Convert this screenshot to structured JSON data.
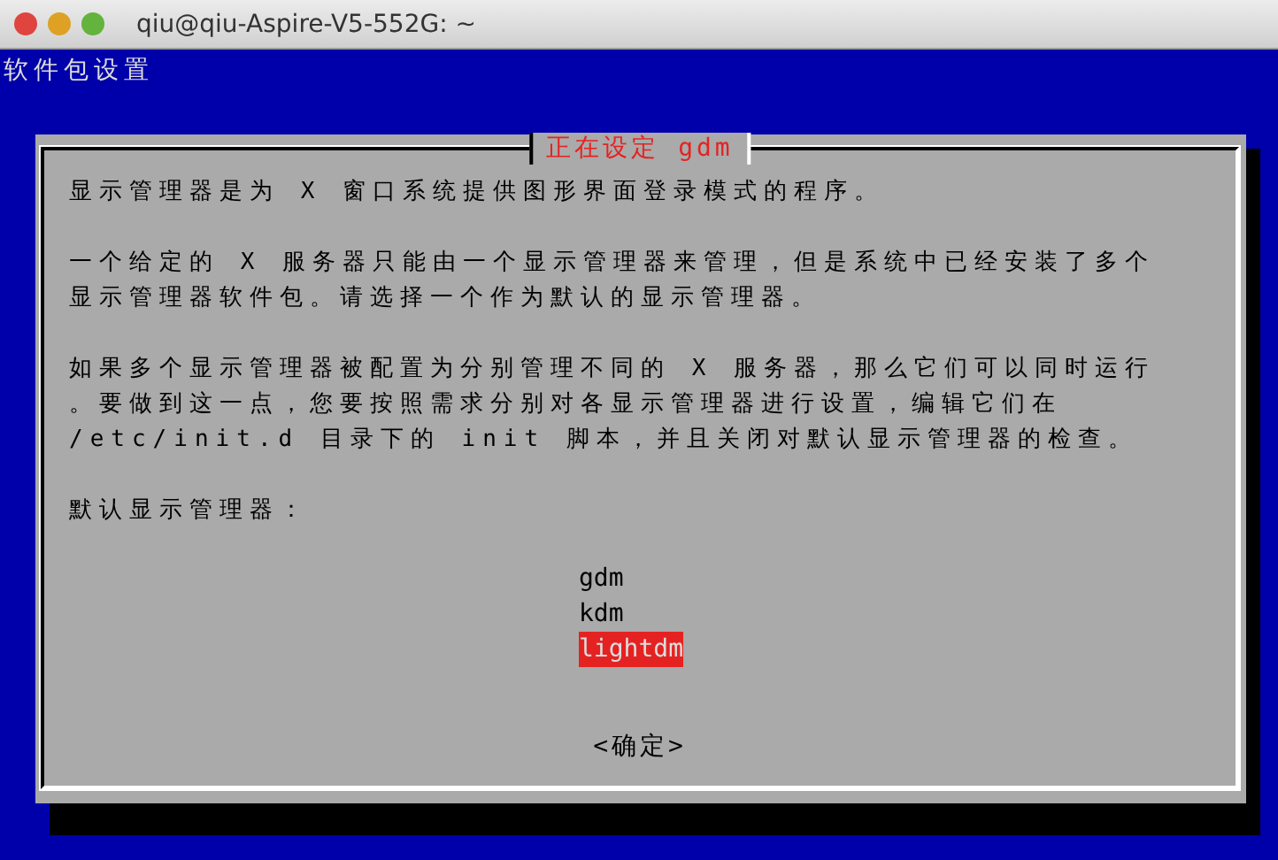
{
  "window": {
    "title": "qiu@qiu-Aspire-V5-552G: ~"
  },
  "header": "软件包设置",
  "dialog": {
    "title": "正在设定 gdm",
    "paragraphs": [
      [
        "显示管理器是为 X 窗口系统提供图形界面登录模式的程序。"
      ],
      [
        "一个给定的 X 服务器只能由一个显示管理器来管理，但是系统中已经安装了多个",
        "显示管理器软件包。请选择一个作为默认的显示管理器。"
      ],
      [
        "如果多个显示管理器被配置为分别管理不同的 X 服务器，那么它们可以同时运行",
        "。要做到这一点，您要按照需求分别对各显示管理器进行设置，编辑它们在",
        "/etc/init.d 目录下的 init 脚本，并且关闭对默认显示管理器的检查。"
      ],
      [
        "默认显示管理器："
      ]
    ],
    "options": [
      {
        "label": "gdm",
        "selected": false
      },
      {
        "label": "kdm",
        "selected": false
      },
      {
        "label": "lightdm",
        "selected": true
      }
    ],
    "button": "<确定>"
  }
}
